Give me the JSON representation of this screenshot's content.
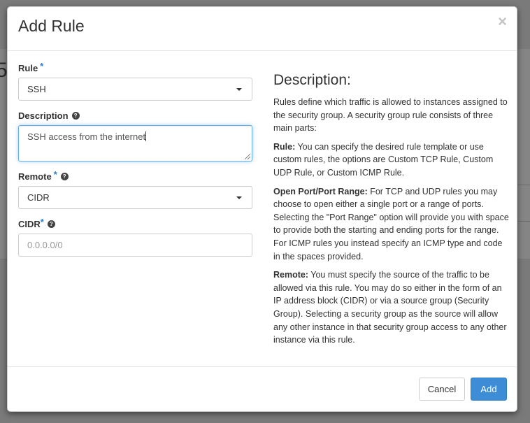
{
  "background": {
    "peek_digit": "5"
  },
  "modal": {
    "title": "Add Rule",
    "close_glyph": "×"
  },
  "form": {
    "rule": {
      "label": "Rule",
      "required_mark": "*",
      "value": "SSH"
    },
    "description": {
      "label": "Description",
      "value": "SSH access from the internet"
    },
    "remote": {
      "label": "Remote",
      "required_mark": "*",
      "value": "CIDR"
    },
    "cidr": {
      "label": "CIDR",
      "required_mark": "*",
      "placeholder": "0.0.0.0/0"
    }
  },
  "help": {
    "title": "Description:",
    "intro": "Rules define which traffic is allowed to instances assigned to the security group. A security group rule consists of three main parts:",
    "rule_term": "Rule:",
    "rule_text": " You can specify the desired rule template or use custom rules, the options are Custom TCP Rule, Custom UDP Rule, or Custom ICMP Rule.",
    "port_term": "Open Port/Port Range:",
    "port_text": " For TCP and UDP rules you may choose to open either a single port or a range of ports. Selecting the \"Port Range\" option will provide you with space to provide both the starting and ending ports for the range. For ICMP rules you instead specify an ICMP type and code in the spaces provided.",
    "remote_term": "Remote:",
    "remote_text": " You must specify the source of the traffic to be allowed via this rule. You may do so either in the form of an IP address block (CIDR) or via a source group (Security Group). Selecting a security group as the source will allow any other instance in that security group access to any other instance via this rule."
  },
  "footer": {
    "cancel_label": "Cancel",
    "add_label": "Add"
  },
  "colors": {
    "primary": "#3c8dd5",
    "required": "#2a7dc9",
    "focus_border": "#66afe9"
  }
}
